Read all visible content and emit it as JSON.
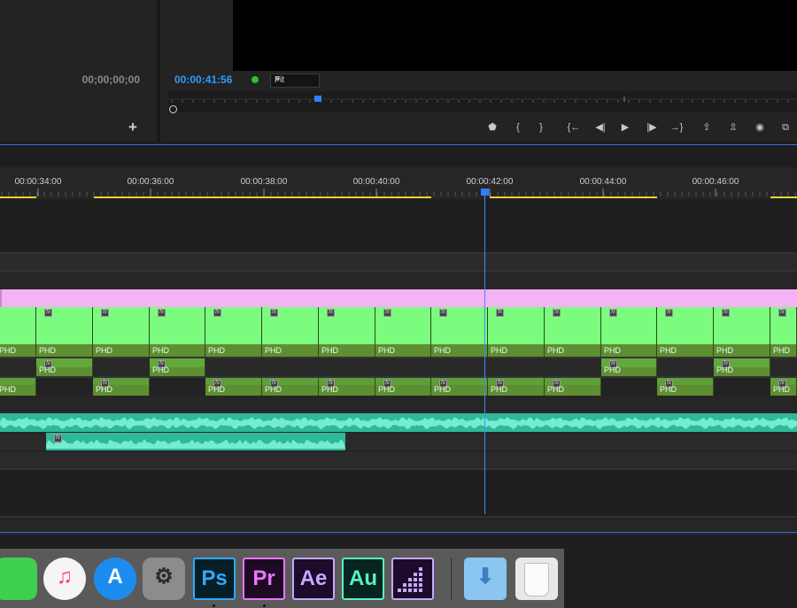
{
  "source_monitor": {
    "timecode": "00;00;00;00",
    "add_button": "+"
  },
  "program_monitor": {
    "timecode": "00:00:41:56",
    "zoom": "Fit",
    "colors": {
      "timecode": "#2f9bff",
      "status": "#2fbf2f"
    },
    "transport_buttons": [
      {
        "icon": "marker-icon",
        "glyph": "⬟"
      },
      {
        "icon": "mark-in-icon",
        "glyph": "{"
      },
      {
        "icon": "mark-out-icon",
        "glyph": "}"
      },
      {
        "icon": "go-to-in-icon",
        "glyph": "{←"
      },
      {
        "icon": "step-back-icon",
        "glyph": "◀|"
      },
      {
        "icon": "play-icon",
        "glyph": "▶"
      },
      {
        "icon": "step-forward-icon",
        "glyph": "|▶"
      },
      {
        "icon": "go-to-out-icon",
        "glyph": "→}"
      },
      {
        "icon": "lift-icon",
        "glyph": "⇪"
      },
      {
        "icon": "extract-icon",
        "glyph": "⇫"
      },
      {
        "icon": "export-frame-icon",
        "glyph": "◉"
      },
      {
        "icon": "comparison-view-icon",
        "glyph": "⧉"
      }
    ]
  },
  "timeline": {
    "ruler_labels": [
      "00:00:34:00",
      "00:00:36:00",
      "00:00:38:00",
      "00:00:40:00",
      "00:00:42:00",
      "00:00:44:00",
      "00:00:46:00"
    ],
    "clip_label": "PHD",
    "colors": {
      "video_clip": "#7cfc7f",
      "video_clip_dark": "#5e8e32",
      "adjustment_clip": "#f5b3f5",
      "audio_clip": "#2fb89a",
      "audio_wave": "#7ff5d8",
      "playhead": "#3d8cff",
      "work_area": "#e5d23a"
    }
  },
  "dock": {
    "apps": [
      {
        "name": "FaceTime",
        "label": ""
      },
      {
        "name": "iTunes",
        "label": "♫"
      },
      {
        "name": "App Store",
        "label": "A"
      },
      {
        "name": "System Preferences",
        "label": "⚙"
      },
      {
        "name": "Photoshop",
        "label": "Ps"
      },
      {
        "name": "Premiere Pro",
        "label": "Pr"
      },
      {
        "name": "After Effects",
        "label": "Ae"
      },
      {
        "name": "Audition",
        "label": "Au"
      },
      {
        "name": "Media Encoder",
        "label": ""
      },
      {
        "name": "Downloads",
        "label": "⬇"
      },
      {
        "name": "Trash",
        "label": ""
      }
    ]
  }
}
